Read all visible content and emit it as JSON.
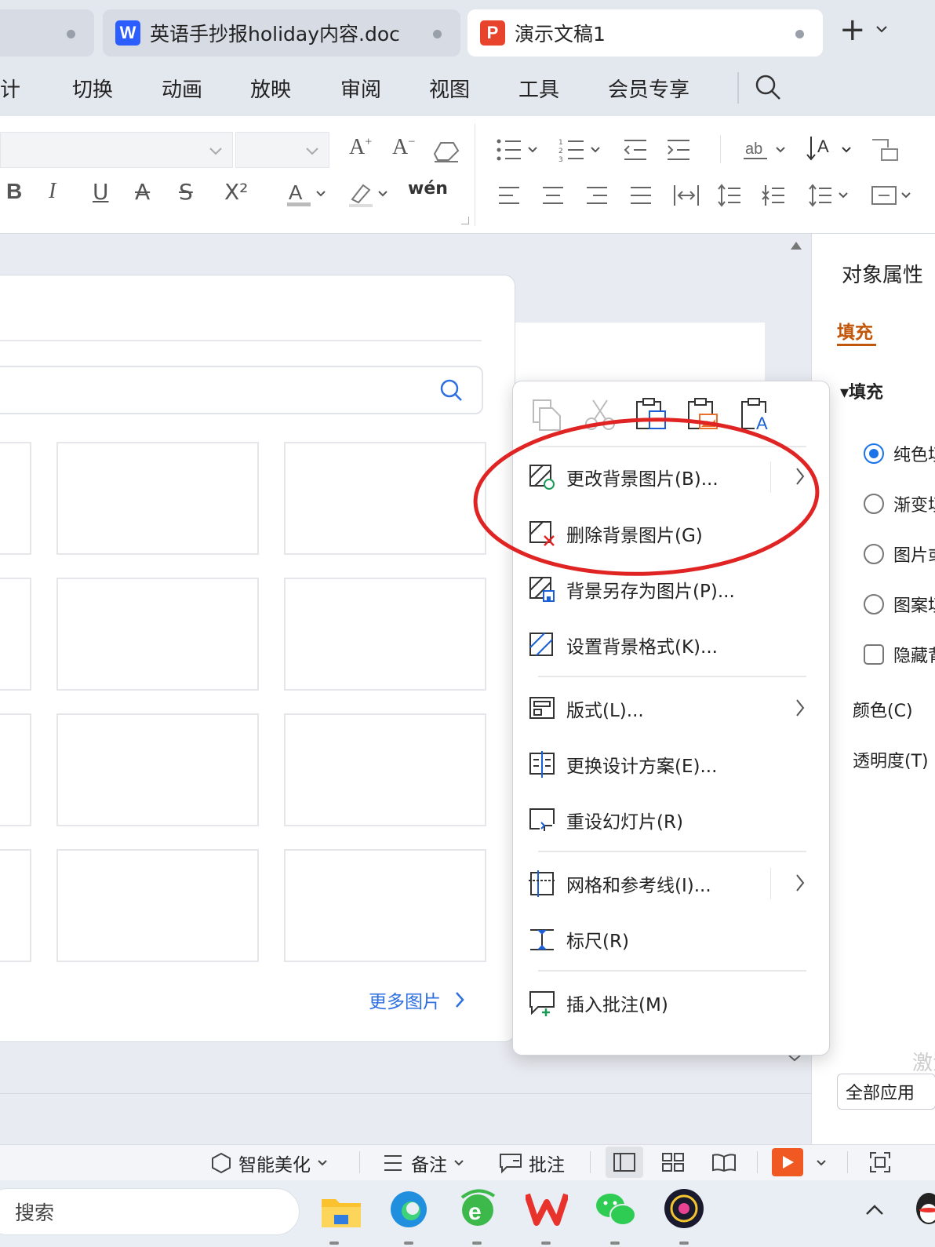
{
  "tabs": [
    {
      "label": ""
    },
    {
      "label": "英语手抄报holiday内容.doc",
      "icon": "W",
      "icon_color": "#2b5dff"
    },
    {
      "label": "演示文稿1",
      "icon": "P",
      "icon_color": "#e8432d"
    }
  ],
  "tab_actions": {
    "add": "+",
    "dropdown": "⌄"
  },
  "menu_tabs": [
    "设计",
    "切换",
    "动画",
    "放映",
    "审阅",
    "视图",
    "工具",
    "会员专享"
  ],
  "menu_partial_first": "计",
  "ribbon": {
    "font_name": "",
    "font_size": "",
    "styles": [
      "B",
      "I",
      "U",
      "A",
      "S",
      "X²"
    ],
    "superscript": "X²",
    "wen": "wén"
  },
  "image_panel": {
    "search_placeholder": "",
    "more_link": "更多图片"
  },
  "context_menu": {
    "items": [
      {
        "label": "更改背景图片(B)...",
        "icon": "change-bg-icon",
        "submenu": true
      },
      {
        "label": "删除背景图片(G)",
        "icon": "delete-bg-icon"
      },
      {
        "label": "背景另存为图片(P)...",
        "icon": "save-bg-icon"
      },
      {
        "label": "设置背景格式(K)...",
        "icon": "bg-format-icon"
      },
      {
        "label": "版式(L)...",
        "icon": "layout-icon",
        "submenu": true
      },
      {
        "label": "更换设计方案(E)...",
        "icon": "design-icon"
      },
      {
        "label": "重设幻灯片(R)",
        "icon": "reset-slide-icon"
      },
      {
        "label": "网格和参考线(I)...",
        "icon": "grid-icon",
        "submenu": true
      },
      {
        "label": "标尺(R)",
        "icon": "ruler-icon"
      },
      {
        "label": "插入批注(M)",
        "icon": "comment-icon"
      }
    ],
    "highlight_color": "#e02424"
  },
  "right_pane": {
    "title": "对象属性",
    "tab": "填充",
    "section": "▾填充",
    "options": [
      "纯色填",
      "渐变填",
      "图片或",
      "图案填"
    ],
    "checkbox": "隐藏背",
    "color_label": "颜色(C)",
    "transparency_label": "透明度(T)",
    "apply_all": "全部应用",
    "watermark": "激活"
  },
  "status_bar": {
    "beautify": "智能美化",
    "notes": "备注",
    "comments": "批注",
    "play_color": "#f05a22"
  },
  "taskbar": {
    "search": "搜索"
  },
  "colors": {
    "accent": "#c2560a",
    "radio": "#1a73e8",
    "link": "#2d6fe0"
  }
}
